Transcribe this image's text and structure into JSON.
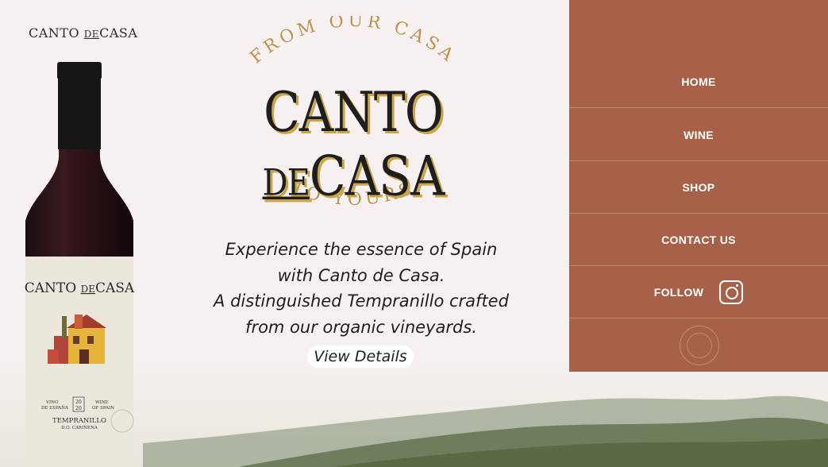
{
  "brand": {
    "small_logo_left": "CANTO",
    "small_logo_de": "DE",
    "small_logo_right": "CASA"
  },
  "hero": {
    "arc_top": "FROM OUR CASA",
    "title_left": "CANTO",
    "title_de": "DE",
    "title_right": "CASA",
    "arc_bottom": "TO YOURS",
    "tagline_lines": [
      "Experience the essence of Spain",
      "with Canto de Casa.",
      "A distinguished Tempranillo crafted",
      "from our organic vineyards."
    ],
    "cta_label": "View Details"
  },
  "bottle_label": {
    "brand_left": "CANTO",
    "brand_de": "DE",
    "brand_right": "CASA",
    "vino": "VINO",
    "de_espana": "DE ESPAÑA",
    "year_top": "20",
    "year_bottom": "20",
    "wine": "WINE",
    "of_spain": "OF SPAIN",
    "varietal": "TEMPRANILLO",
    "appellation": "D.O. CARIÑENA"
  },
  "nav": {
    "items": [
      {
        "label": "HOME"
      },
      {
        "label": "WINE"
      },
      {
        "label": "SHOP"
      },
      {
        "label": "CONTACT US"
      },
      {
        "label": "FOLLOW"
      }
    ]
  },
  "colors": {
    "background": "#f6f1f0",
    "nav_panel": "#a86149",
    "gold": "#b8964e",
    "title_shadow": "#c9a64a"
  },
  "icons": [
    "instagram-icon",
    "seal-icon"
  ]
}
